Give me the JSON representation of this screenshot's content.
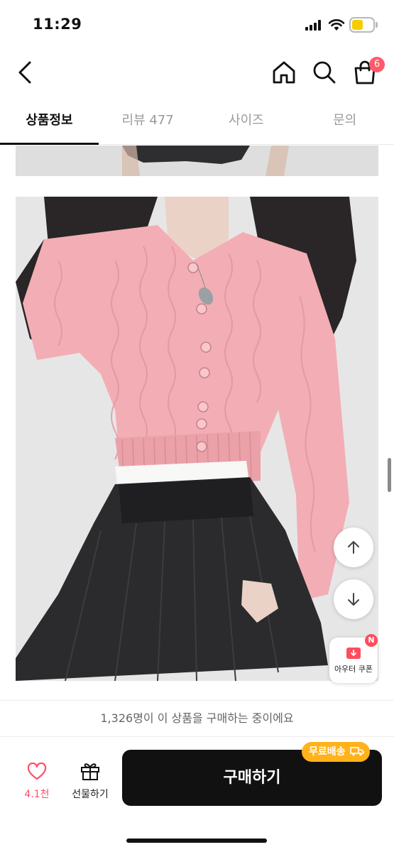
{
  "status_bar": {
    "time": "11:29"
  },
  "header": {
    "cart_count": "6"
  },
  "tabs": [
    {
      "label": "상품정보"
    },
    {
      "label": "리뷰 477"
    },
    {
      "label": "사이즈"
    },
    {
      "label": "문의"
    }
  ],
  "floating": {
    "coupon_label": "아우터 쿠폰",
    "coupon_badge": "N"
  },
  "buyers_note": "1,326명이 이 상품을 구매하는 중이에요",
  "bottom": {
    "like_count": "4.1천",
    "gift_label": "선물하기",
    "buy_label": "구매하기",
    "free_shipping": "무료배송"
  },
  "colors": {
    "accent": "#ff4d6d",
    "free_shipping": "#ffb21a",
    "buy_button": "#111111"
  }
}
